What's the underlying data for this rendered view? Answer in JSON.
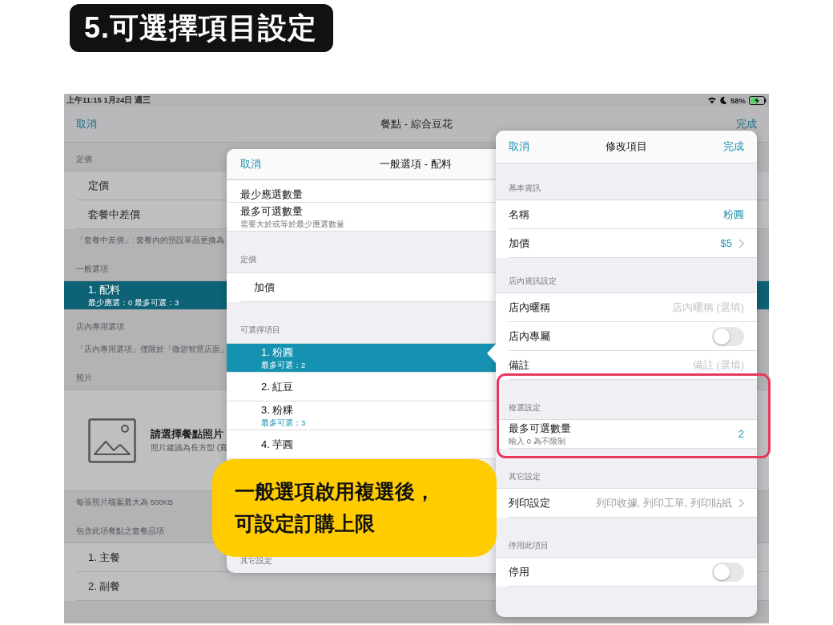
{
  "title_badge": "5.可選擇項目設定",
  "background": {
    "status_bar": {
      "time": "上午11:15 1月24日 週三",
      "battery": "58%"
    },
    "nav": {
      "cancel": "取消",
      "title": "餐點 - 綜合豆花",
      "done": "完成"
    },
    "sections": [
      {
        "header": "定價",
        "rows": [
          {
            "kind": "plain",
            "label": "定價"
          },
          {
            "kind": "plain",
            "label": "套餐中差價"
          }
        ],
        "footer": "「套餐中差價」: 套餐內的預設單品更換為"
      },
      {
        "header": "一般選項",
        "rows": [
          {
            "kind": "subtitle",
            "label": "1. 配料",
            "detail": "最少應選：0 最多可選：3",
            "selected": true
          }
        ]
      },
      {
        "header": "店內專用選項",
        "footer": "「店內專用選項」僅限於「微碧智慧店面」"
      },
      {
        "header": "照片",
        "rows": [
          {
            "kind": "photo",
            "label": "請選擇餐點照片",
            "detail": "照片建議為長方型 (寬"
          }
        ],
        "footer": "每張照片檔案最大為 500KB"
      },
      {
        "header": "包含此項餐點之套餐品項",
        "rows": [
          {
            "kind": "plain",
            "label": "1. 主餐"
          },
          {
            "kind": "plain",
            "label": "2. 副餐"
          }
        ]
      }
    ]
  },
  "option_sheet": {
    "cancel": "取消",
    "title": "一般選項 - 配料",
    "sections": [
      {
        "rows": [
          {
            "kind": "clipped",
            "label": "最少應選數量"
          },
          {
            "kind": "subtitle",
            "label": "最多可選數量",
            "detail": "需要大於或等於最少應選數量"
          }
        ]
      },
      {
        "header": "定價",
        "rows": [
          {
            "kind": "plain",
            "label": "加價"
          }
        ]
      },
      {
        "header": "可選擇項目",
        "rows": [
          {
            "kind": "item",
            "label": "1. 粉圓",
            "detail": "最多可選：2",
            "selected": true
          },
          {
            "kind": "item",
            "label": "2. 紅豆",
            "selected": false
          },
          {
            "kind": "item",
            "label": "3. 粉粿",
            "detail": "最多可選：3",
            "selected": false
          },
          {
            "kind": "item",
            "label": "4. 芋圓",
            "selected": false
          }
        ]
      },
      {
        "header": "其它設定"
      }
    ]
  },
  "edit_sheet": {
    "cancel": "取消",
    "title": "修改項目",
    "done": "完成",
    "sections": [
      {
        "header": "基本資訊",
        "rows": [
          {
            "kind": "value",
            "label": "名稱",
            "value": "粉圓"
          },
          {
            "kind": "link",
            "label": "加價",
            "value": "$5"
          }
        ]
      },
      {
        "header": "店內資訊設定",
        "rows": [
          {
            "kind": "input",
            "label": "店內暱稱",
            "placeholder": "店內暱稱 (選填)"
          },
          {
            "kind": "toggle",
            "label": "店內專屬",
            "on": false
          },
          {
            "kind": "input",
            "label": "備註",
            "placeholder": "備註 (選填)"
          }
        ]
      },
      {
        "header": "複選設定",
        "highlighted": true,
        "rows": [
          {
            "kind": "value",
            "label": "最多可選數量",
            "detail": "輸入 0 為不限制",
            "value": "2"
          }
        ]
      },
      {
        "header": "其它設定",
        "rows": [
          {
            "kind": "summary",
            "label": "列印設定",
            "value": "列印收據, 列印工單, 列印貼紙"
          }
        ]
      },
      {
        "header": "停用此項目",
        "rows": [
          {
            "kind": "toggle",
            "label": "停用",
            "on": false
          }
        ]
      }
    ]
  },
  "callout": {
    "lines": [
      "一般選項啟用複選後，",
      "可設定訂購上限"
    ]
  }
}
